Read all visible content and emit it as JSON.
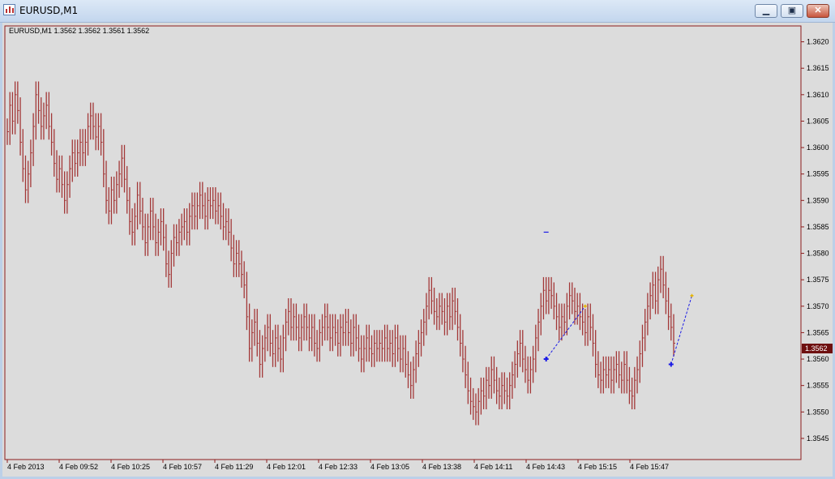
{
  "window": {
    "title": "EURUSD,M1",
    "icon": "chart-window-icon",
    "buttons": {
      "minimize": "minimize-icon",
      "restore": "restore-icon",
      "close": "close-icon"
    }
  },
  "chart_data": {
    "type": "bar",
    "header": "EURUSD,M1  1.3562 1.3562 1.3561 1.3562",
    "price_axis": {
      "ticks": [
        "1.3620",
        "1.3615",
        "1.3610",
        "1.3605",
        "1.3600",
        "1.3595",
        "1.3590",
        "1.3585",
        "1.3580",
        "1.3575",
        "1.3570",
        "1.3565",
        "1.3560",
        "1.3555",
        "1.3550",
        "1.3545"
      ],
      "ylim": [
        1.3541,
        1.3623
      ],
      "current_price": "1.3562",
      "current_value": 1.3562
    },
    "time_axis": {
      "labels": [
        "4 Feb 2013",
        "4 Feb 09:52",
        "4 Feb 10:25",
        "4 Feb 10:57",
        "4 Feb 11:29",
        "4 Feb 12:01",
        "4 Feb 12:33",
        "4 Feb 13:05",
        "4 Feb 13:38",
        "4 Feb 14:11",
        "4 Feb 14:43",
        "4 Feb 15:15",
        "4 Feb 15:47"
      ]
    },
    "series": [
      {
        "closes": [
          1.3603,
          1.3608,
          1.3605,
          1.361,
          1.3607,
          1.3601,
          1.3596,
          1.3592,
          1.3595,
          1.3599,
          1.3604,
          1.361,
          1.3607,
          1.3604,
          1.3606,
          1.3608,
          1.3604,
          1.3601,
          1.3597,
          1.3594,
          1.3596,
          1.3593,
          1.359,
          1.3593,
          1.3596,
          1.3599,
          1.3597,
          1.3599,
          1.3601,
          1.3599,
          1.3601,
          1.3604,
          1.3606,
          1.3604,
          1.3602,
          1.3604,
          1.3601,
          1.3595,
          1.359,
          1.3588,
          1.3592,
          1.359,
          1.3593,
          1.3595,
          1.3598,
          1.3594,
          1.359,
          1.3586,
          1.3584,
          1.3587,
          1.3591,
          1.3588,
          1.3585,
          1.3582,
          1.3585,
          1.3588,
          1.3585,
          1.3582,
          1.3584,
          1.3586,
          1.3583,
          1.3578,
          1.3576,
          1.358,
          1.3583,
          1.3582,
          1.3584,
          1.3585,
          1.3586,
          1.3584,
          1.3587,
          1.3589,
          1.3587,
          1.3589,
          1.3591,
          1.3589,
          1.3587,
          1.359,
          1.3589,
          1.359,
          1.3588,
          1.3589,
          1.3587,
          1.3585,
          1.3586,
          1.3584,
          1.3581,
          1.3578,
          1.358,
          1.3578,
          1.3576,
          1.3574,
          1.3568,
          1.3562,
          1.3565,
          1.3567,
          1.3563,
          1.3559,
          1.3562,
          1.3564,
          1.3566,
          1.3563,
          1.3561,
          1.3564,
          1.3562,
          1.356,
          1.3564,
          1.3567,
          1.3569,
          1.3566,
          1.3568,
          1.3566,
          1.3564,
          1.3566,
          1.3568,
          1.3566,
          1.3564,
          1.3566,
          1.3563,
          1.3562,
          1.3565,
          1.3566,
          1.3568,
          1.3566,
          1.3564,
          1.3566,
          1.3565,
          1.3563,
          1.3566,
          1.3565,
          1.3567,
          1.3565,
          1.3563,
          1.3566,
          1.3564,
          1.3562,
          1.356,
          1.3562,
          1.3564,
          1.3562,
          1.3561,
          1.3563,
          1.3562,
          1.3563,
          1.3562,
          1.3564,
          1.3562,
          1.3563,
          1.3561,
          1.3564,
          1.3562,
          1.356,
          1.3562,
          1.3559,
          1.3557,
          1.3555,
          1.3558,
          1.3561,
          1.3563,
          1.3565,
          1.3567,
          1.357,
          1.3573,
          1.3571,
          1.3569,
          1.3568,
          1.357,
          1.3569,
          1.3567,
          1.357,
          1.3568,
          1.3571,
          1.3569,
          1.3566,
          1.3563,
          1.356,
          1.3557,
          1.3554,
          1.3552,
          1.3551,
          1.355,
          1.3552,
          1.3554,
          1.3553,
          1.3556,
          1.3555,
          1.3558,
          1.3556,
          1.3554,
          1.3553,
          1.3555,
          1.3554,
          1.3553,
          1.3555,
          1.3557,
          1.3559,
          1.3561,
          1.3563,
          1.356,
          1.3558,
          1.3556,
          1.3558,
          1.356,
          1.3564,
          1.3567,
          1.357,
          1.3573,
          1.3571,
          1.3573,
          1.3572,
          1.357,
          1.3568,
          1.3566,
          1.3568,
          1.3567,
          1.357,
          1.3572,
          1.3571,
          1.3569,
          1.357,
          1.3568,
          1.3567,
          1.3565,
          1.3568,
          1.3566,
          1.3563,
          1.3559,
          1.3557,
          1.3556,
          1.3558,
          1.3557,
          1.3558,
          1.3556,
          1.3558,
          1.3559,
          1.3557,
          1.3556,
          1.3559,
          1.3556,
          1.3554,
          1.3553,
          1.3556,
          1.3558,
          1.3561,
          1.3564,
          1.3567,
          1.357,
          1.3572,
          1.3574,
          1.3571,
          1.3575,
          1.3577,
          1.3574,
          1.3571,
          1.3568,
          1.3566,
          1.3563
        ]
      }
    ],
    "range_bars": 250,
    "trades": [
      {
        "entry_value": 1.356,
        "exit_value": 1.357
      },
      {
        "entry_value": 1.3559,
        "exit_value": 1.3572
      }
    ],
    "marker_value": 1.3584,
    "colors": {
      "bars": "#a33838",
      "background": "#dcdcdc",
      "axis": "#8b1c1c",
      "trade_line": "#1a1ae6",
      "exit_marker": "#e5b400",
      "current_price_bg": "#6e0f0f"
    },
    "grid": false
  }
}
